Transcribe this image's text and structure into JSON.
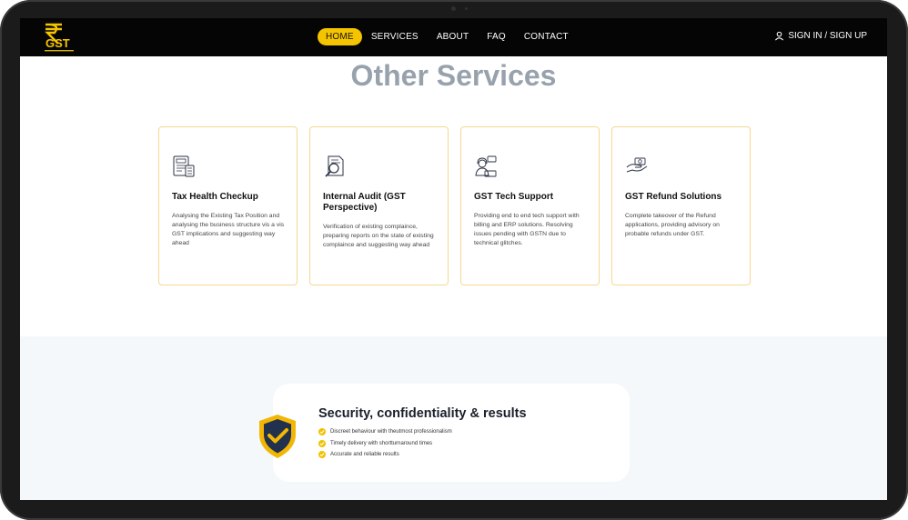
{
  "nav": {
    "logo_text": "GST",
    "items": [
      {
        "label": "HOME",
        "active": true
      },
      {
        "label": "SERVICES",
        "active": false
      },
      {
        "label": "ABOUT",
        "active": false
      },
      {
        "label": "FAQ",
        "active": false
      },
      {
        "label": "CONTACT",
        "active": false
      }
    ],
    "signin_label": "SIGN IN / SIGN UP"
  },
  "section": {
    "title": "Other Services"
  },
  "cards": [
    {
      "icon": "tax-document-icon",
      "title": "Tax Health Checkup",
      "desc": "Analysing the Existing Tax Position and analysing the business structure vis a vis GST implications and suggesting way ahead"
    },
    {
      "icon": "audit-report-icon",
      "title": "Internal Audit (GST Perspective)",
      "desc": "Verification of existing complaince, preparing reports on the state of existing complaince and suggesting way ahead"
    },
    {
      "icon": "tech-support-icon",
      "title": "GST Tech Support",
      "desc": "Providing end to end tech support with billing and ERP solutions. Resolving issues pending with GSTN due to technical glitches."
    },
    {
      "icon": "refund-money-icon",
      "title": "GST Refund Solutions",
      "desc": "Complete takeover of the Refund applications, providing advisory on probable refunds under GST."
    }
  ],
  "security": {
    "title": "Security, confidentiality & results",
    "items": [
      "Discreet behaviour with theutmost professionalism",
      "Timely delivery with shortturnaround times",
      "Accurate and reliable results"
    ]
  },
  "colors": {
    "accent": "#f5c400",
    "nav_bg": "#050505",
    "title_gray": "#98a2ad",
    "card_border": "#f6d88f"
  }
}
